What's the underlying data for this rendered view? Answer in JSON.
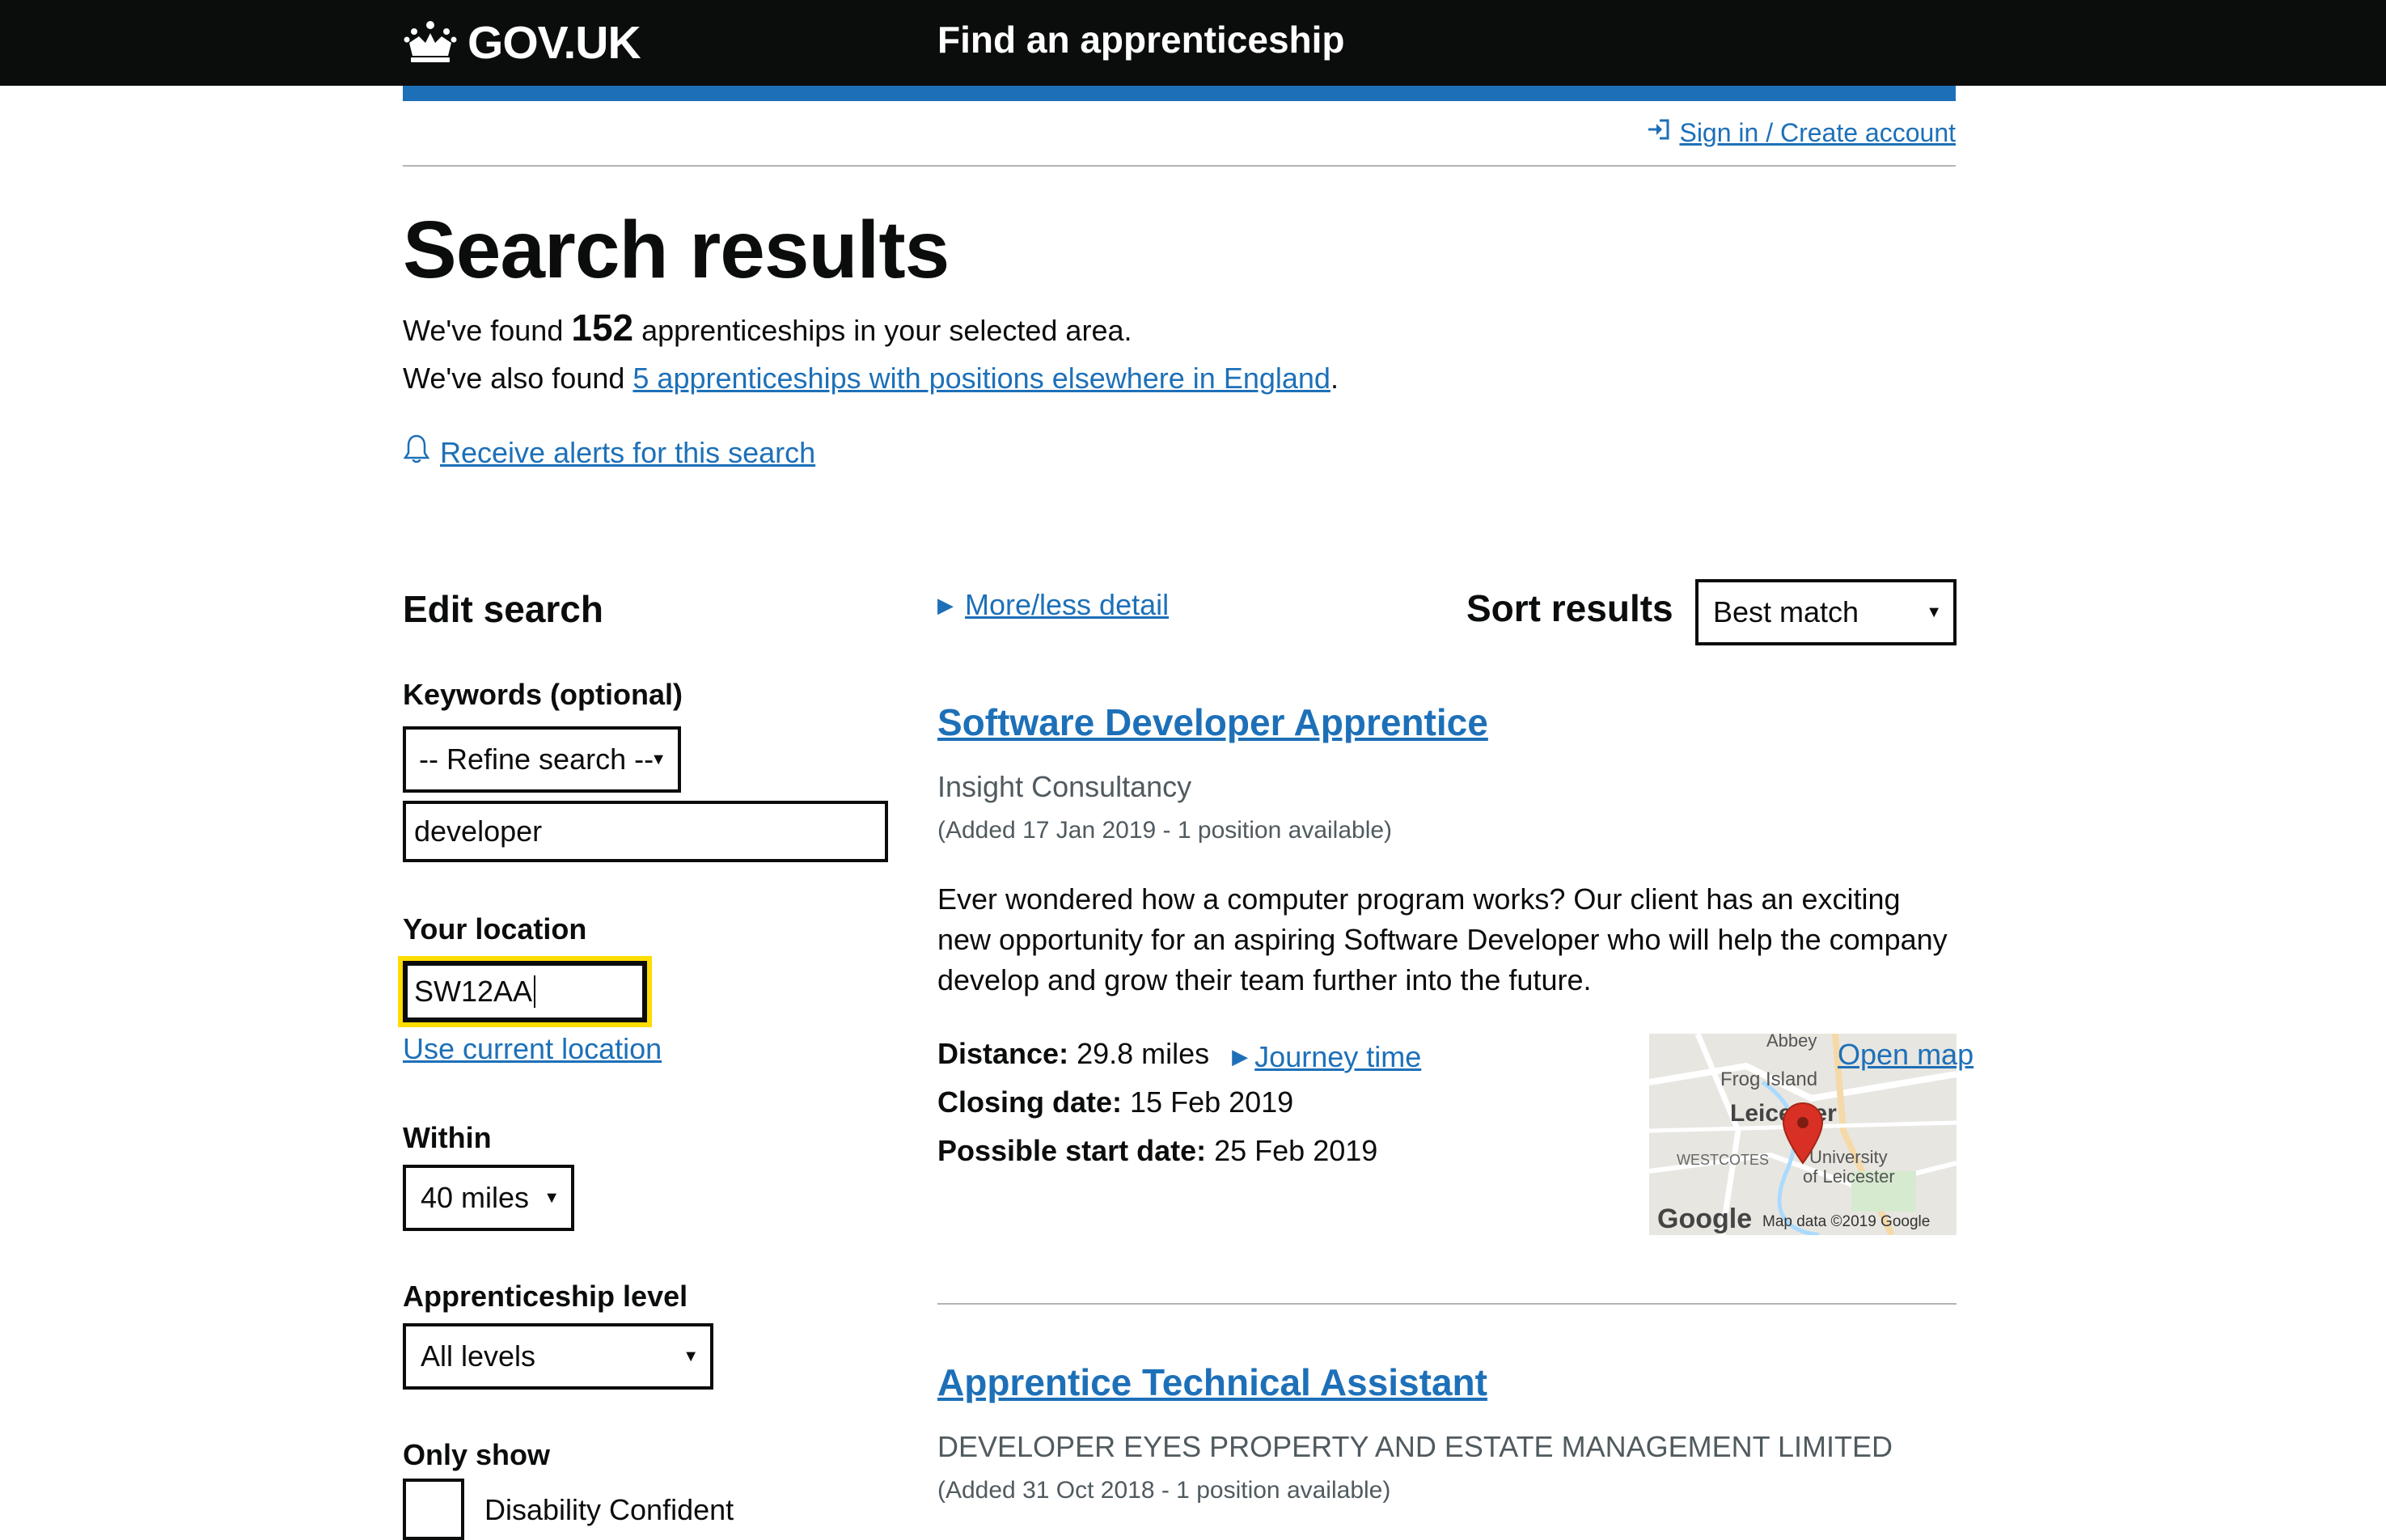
{
  "header": {
    "logo_text": "GOV.UK",
    "service_name": "Find an apprenticeship"
  },
  "account": {
    "signin_label": "Sign in / Create account"
  },
  "page": {
    "title": "Search results",
    "found_prefix": "We've found",
    "found_count": "152",
    "found_suffix": "apprenticeships in your selected area.",
    "also_prefix": "We've also found",
    "also_link": "5 apprenticeships with positions elsewhere in England",
    "also_suffix": ".",
    "alerts_link": "Receive alerts for this search"
  },
  "edit_search": {
    "title": "Edit search",
    "keywords_label": "Keywords (optional)",
    "refine_select": "-- Refine search --",
    "keywords_value": "developer",
    "location_label": "Your location",
    "location_value": "SW12AA",
    "use_current_location": "Use current location",
    "within_label": "Within",
    "within_value": "40 miles",
    "level_label": "Apprenticeship level",
    "level_value": "All levels",
    "only_show_label": "Only show",
    "disability_label": "Disability Confident"
  },
  "results_controls": {
    "more_less": "More/less detail",
    "sort_label": "Sort results",
    "sort_value": "Best match"
  },
  "results": [
    {
      "title": "Software Developer Apprentice",
      "employer": "Insight Consultancy",
      "added": "(Added 17 Jan 2019 - 1 position available)",
      "description": "Ever wondered how a computer program works? Our client has an exciting new opportunity for an aspiring Software Developer who will help the company develop and grow their team further into the future.",
      "distance_label": "Distance:",
      "distance_value": "29.8 miles",
      "journey_link": "Journey time",
      "closing_label": "Closing date:",
      "closing_value": "15 Feb 2019",
      "start_label": "Possible start date:",
      "start_value": "25 Feb 2019",
      "map": {
        "open_map": "Open map",
        "labels": [
          "Abbey",
          "Frog Island",
          "Leicester",
          "WESTCOTES",
          "University",
          "of Leicester",
          "Google",
          "Map data ©2019 Google"
        ]
      }
    },
    {
      "title": "Apprentice Technical Assistant",
      "employer": "DEVELOPER EYES PROPERTY AND ESTATE MANAGEMENT LIMITED",
      "added": "(Added 31 Oct 2018 - 1 position available)"
    }
  ],
  "icons": {
    "crown": "crown-icon",
    "signin": "sign-in-icon",
    "bell": "bell-icon",
    "pin": "map-pin-icon"
  },
  "colors": {
    "header_bg": "#0b0c0c",
    "link": "#1d70b8",
    "focus": "#ffdd00",
    "map_pin": "#d93025"
  }
}
